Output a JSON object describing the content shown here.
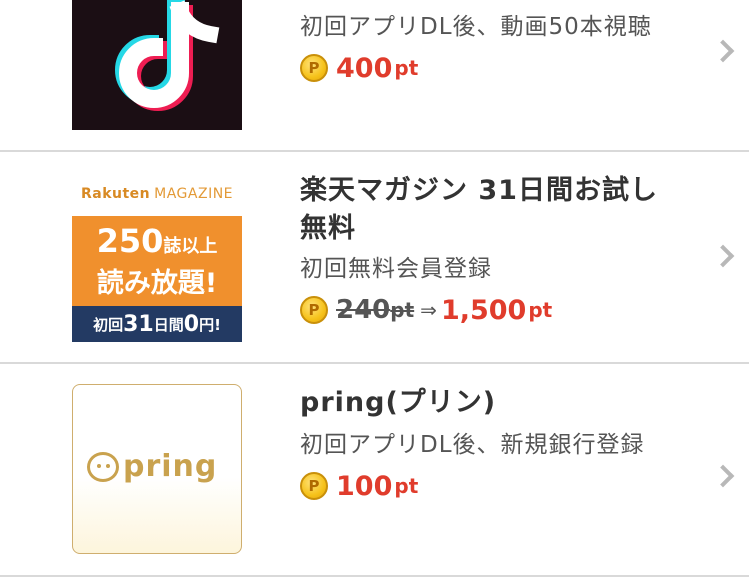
{
  "offers": [
    {
      "thumbnail_icon": "tiktok-logo-icon",
      "subtitle": "初回アプリDL後、動画50本視聴",
      "points": "400",
      "unit": "pt"
    },
    {
      "thumbnail": {
        "brand": "Rakuten",
        "brand_suffix": "MAGAZINE",
        "line1_number": "250",
        "line1_text": "誌以上",
        "line2": "読み放題!",
        "line3_prefix": "初回",
        "line3_days": "31",
        "line3_mid": "日間",
        "line3_zero": "0",
        "line3_suffix": "円!"
      },
      "title": "楽天マガジン 31日間お試し無料",
      "subtitle": "初回無料会員登録",
      "old_points": "240",
      "old_unit": "pt",
      "arrow": "⇒",
      "points": "1,500",
      "unit": "pt"
    },
    {
      "thumbnail": {
        "logo_text": "pring"
      },
      "title": "pring(プリン)",
      "subtitle": "初回アプリDL後、新規銀行登録",
      "points": "100",
      "unit": "pt"
    }
  ],
  "point_badge": "P",
  "colors": {
    "accent_red": "#e03c2c",
    "divider": "#d9d9d9",
    "coin": "#f6c21a"
  }
}
